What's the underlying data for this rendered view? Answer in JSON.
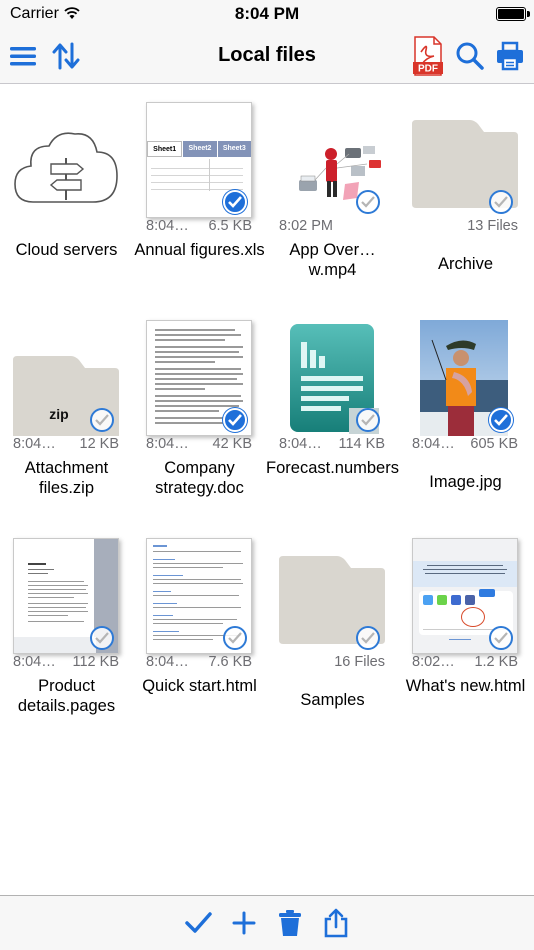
{
  "status": {
    "carrier": "Carrier",
    "time": "8:04 PM"
  },
  "nav": {
    "title": "Local files",
    "pdf_label": "PDF"
  },
  "accent": "#1e6fd9",
  "files": [
    {
      "meta_left": "",
      "meta_right": "",
      "label": "Cloud servers",
      "checked": null
    },
    {
      "meta_left": "8:04…",
      "meta_right": "6.5 KB",
      "label": "Annual figures.xls",
      "checked": true
    },
    {
      "meta_left": "8:02 PM",
      "meta_right": "",
      "label": "App Over…w.mp4",
      "checked": false
    },
    {
      "meta_left": "",
      "meta_right": "13 Files",
      "label": "Archive",
      "checked": false
    },
    {
      "meta_left": "8:04…",
      "meta_right": "12 KB",
      "label": "Attachment files.zip",
      "checked": false,
      "zip": "zip"
    },
    {
      "meta_left": "8:04…",
      "meta_right": "42 KB",
      "label": "Company strategy.doc",
      "checked": true
    },
    {
      "meta_left": "8:04…",
      "meta_right": "114 KB",
      "label": "Forecast.numbers",
      "checked": false
    },
    {
      "meta_left": "8:04…",
      "meta_right": "605 KB",
      "label": "Image.jpg",
      "checked": true
    },
    {
      "meta_left": "8:04…",
      "meta_right": "112 KB",
      "label": "Product details.pages",
      "checked": false
    },
    {
      "meta_left": "8:04…",
      "meta_right": "7.6 KB",
      "label": "Quick start.html",
      "checked": false
    },
    {
      "meta_left": "",
      "meta_right": "16 Files",
      "label": "Samples",
      "checked": false
    },
    {
      "meta_left": "8:02…",
      "meta_right": "1.2 KB",
      "label": "What's new.html",
      "checked": false
    }
  ],
  "sheet": {
    "tab1": "Sheet1",
    "tab2": "Sheet2",
    "tab3": "Sheet3"
  },
  "toolbar": {
    "icons": [
      "checkmark-icon",
      "plus-icon",
      "trash-icon",
      "share-icon"
    ]
  }
}
